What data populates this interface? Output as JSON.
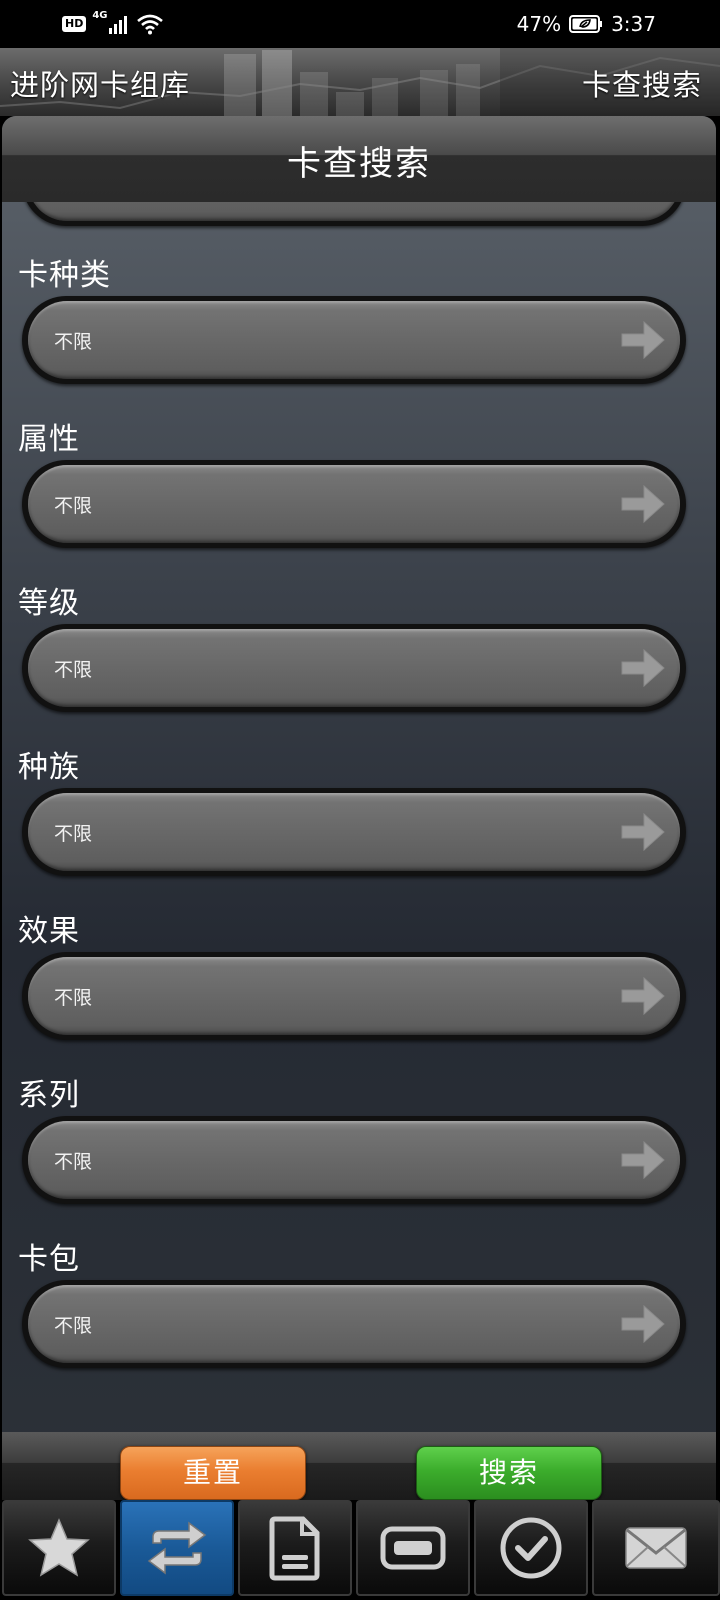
{
  "status_bar": {
    "hd": "HD",
    "network": "4G",
    "battery": "47%",
    "time": "3:37"
  },
  "header": {
    "app_title": "进阶网卡组库",
    "action_label": "卡查搜索"
  },
  "panel": {
    "title": "卡查搜索"
  },
  "filters": [
    {
      "label": "卡种类",
      "value": "不限"
    },
    {
      "label": "属性",
      "value": "不限"
    },
    {
      "label": "等级",
      "value": "不限"
    },
    {
      "label": "种族",
      "value": "不限"
    },
    {
      "label": "效果",
      "value": "不限"
    },
    {
      "label": "系列",
      "value": "不限"
    },
    {
      "label": "卡包",
      "value": "不限"
    }
  ],
  "actions": {
    "reset_label": "重置",
    "search_label": "搜索"
  },
  "tabs": [
    {
      "icon": "star-icon",
      "active": false
    },
    {
      "icon": "swap-icon",
      "active": true
    },
    {
      "icon": "document-icon",
      "active": false
    },
    {
      "icon": "card-icon",
      "active": false
    },
    {
      "icon": "check-circle-icon",
      "active": false
    },
    {
      "icon": "mail-icon",
      "active": false
    }
  ],
  "colors": {
    "reset_button": "#ea7e30",
    "search_button": "#3cad2c",
    "active_tab": "#1a5a98"
  }
}
